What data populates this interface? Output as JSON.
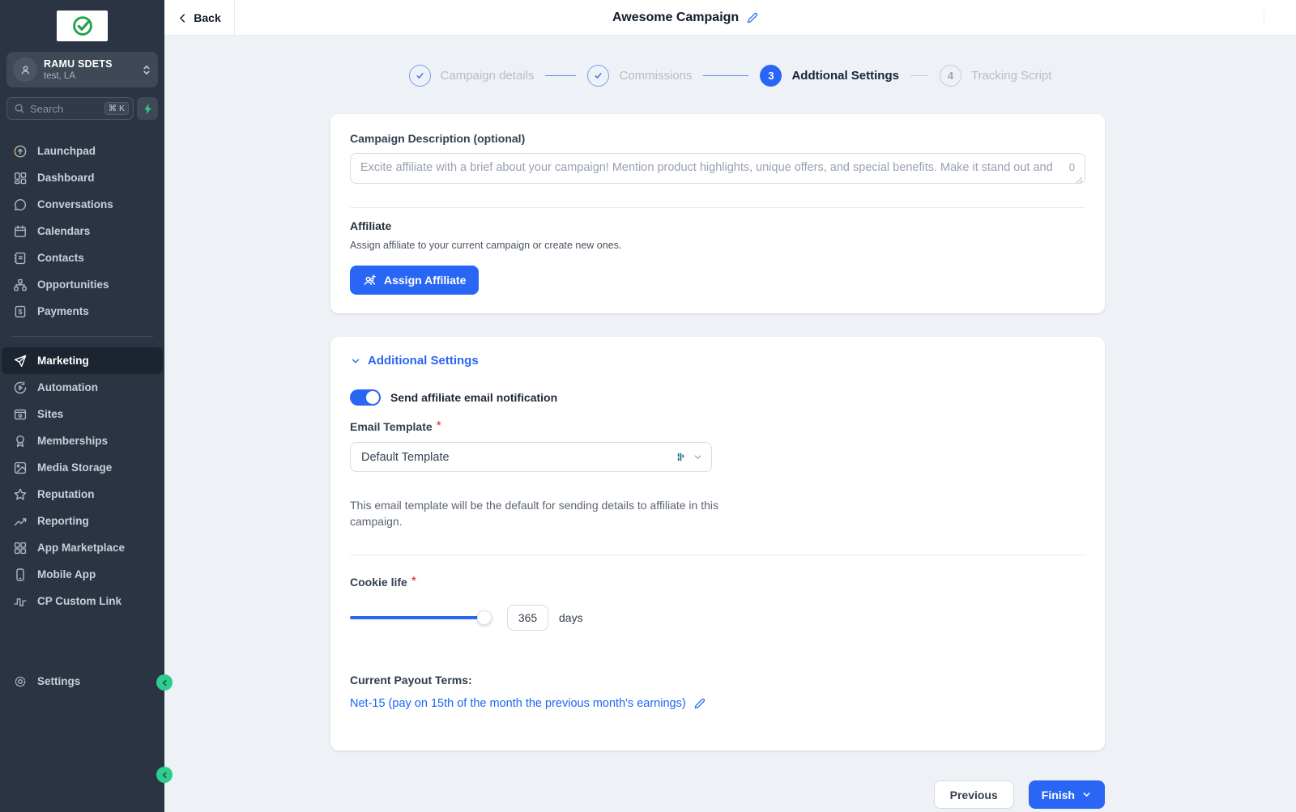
{
  "colors": {
    "primary_blue": "#2a66f5",
    "sidebar_bg": "#2b3443",
    "content_bg": "#eef1f5",
    "green_accent": "#2ecc8e",
    "link_blue": "#1a66f2",
    "required_red": "#e02424"
  },
  "sidebar": {
    "user": {
      "name": "RAMU SDETS",
      "location": "test, LA"
    },
    "search": {
      "placeholder": "Search",
      "shortcut": "⌘ K"
    },
    "nav_main": [
      {
        "label": "Launchpad"
      },
      {
        "label": "Dashboard"
      },
      {
        "label": "Conversations"
      },
      {
        "label": "Calendars"
      },
      {
        "label": "Contacts"
      },
      {
        "label": "Opportunities"
      },
      {
        "label": "Payments"
      }
    ],
    "nav_secondary": [
      {
        "label": "Marketing",
        "active": true
      },
      {
        "label": "Automation"
      },
      {
        "label": "Sites"
      },
      {
        "label": "Memberships"
      },
      {
        "label": "Media Storage"
      },
      {
        "label": "Reputation"
      },
      {
        "label": "Reporting"
      },
      {
        "label": "App Marketplace"
      },
      {
        "label": "Mobile App"
      },
      {
        "label": "CP Custom Link"
      }
    ],
    "settings_label": "Settings"
  },
  "topbar": {
    "back_label": "Back",
    "title": "Awesome Campaign"
  },
  "stepper": {
    "steps": [
      {
        "label": "Campaign details",
        "state": "completed"
      },
      {
        "label": "Commissions",
        "state": "completed"
      },
      {
        "label": "Addtional Settings",
        "number": "3",
        "state": "active"
      },
      {
        "label": "Tracking Script",
        "number": "4",
        "state": "upcoming"
      }
    ]
  },
  "description_card": {
    "label": "Campaign Description (optional)",
    "placeholder": "Excite affiliate with a brief about your campaign! Mention product highlights, unique offers, and special benefits. Make it stand out and",
    "char_count": "0",
    "affiliate_heading": "Affiliate",
    "affiliate_help": "Assign affiliate to your current campaign or create new ones.",
    "assign_button": "Assign Affiliate"
  },
  "settings_card": {
    "heading": "Additional Settings",
    "toggle_label": "Send affiliate email notification",
    "toggle_on": true,
    "email_template_label": "Email Template",
    "required_marker": "*",
    "email_template_value": "Default Template",
    "email_template_help": "This email template will be the default for sending details to affiliate in this campaign.",
    "cookie_life_label": "Cookie life",
    "cookie_life_value": "365",
    "cookie_life_unit": "days",
    "payout_label": "Current Payout Terms:",
    "payout_link": "Net-15 (pay on 15th of the month the previous month's earnings)"
  },
  "footer": {
    "previous_label": "Previous",
    "finish_label": "Finish"
  }
}
